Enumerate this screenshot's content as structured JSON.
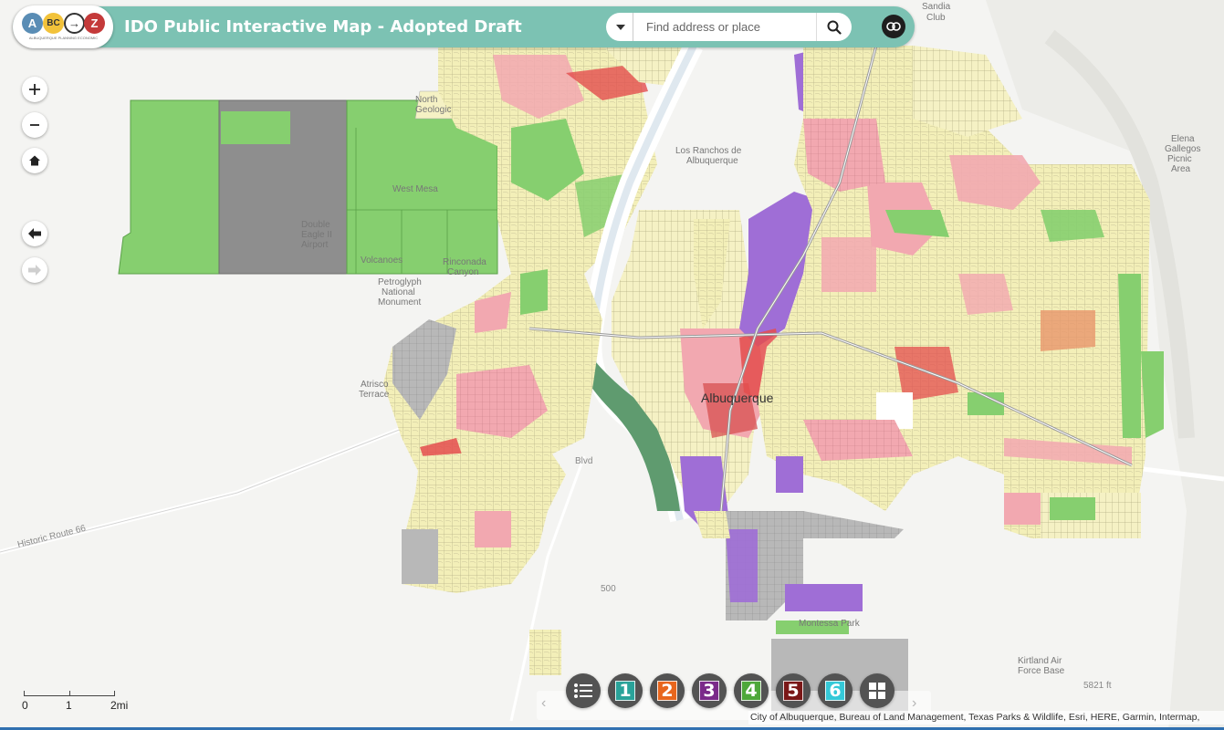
{
  "header": {
    "title": "IDO Public Interactive Map - Adopted Draft",
    "logo_letters": [
      "A",
      "BC",
      "→",
      "Z"
    ],
    "logo_tagline": "ALBUQUERQUE PLANNING ECONOMIC"
  },
  "search": {
    "placeholder": "Find address or place"
  },
  "map_labels": {
    "city": "Albuquerque",
    "los_ranchos": "Los Ranchos de",
    "los_ranchos_2": "Albuquerque",
    "west_mesa": "West Mesa",
    "double_eagle": "Double",
    "double_eagle_2": "Eagle II",
    "double_eagle_3": "Airport",
    "volcanoes": "Volcanoes",
    "rinconada": "Rinconada",
    "rinconada_2": "Canyon",
    "petroglyph": "Petroglyph",
    "petroglyph_2": "National",
    "petroglyph_3": "Monument",
    "atrisco": "Atrisco",
    "atrisco_2": "Terrace",
    "elena": "Elena",
    "elena_2": "Gallegos",
    "elena_3": "Picnic",
    "elena_4": "Area",
    "kirtland": "Kirtland Air",
    "kirtland_2": "Force Base",
    "sandia_club": "Club",
    "sandia": "Sandia",
    "historic_route": "Historic Route 66",
    "route_500": "500",
    "blvd": "Blvd",
    "elevation": "5821 ft",
    "montessa": "Montessa Park",
    "north_geologic": "North",
    "north_geologic_2": "Geologic"
  },
  "scale": {
    "labels": [
      "0",
      "1",
      "2mi"
    ]
  },
  "toolbar": {
    "buttons": [
      {
        "label": "1",
        "color": "#2aa39a"
      },
      {
        "label": "2",
        "color": "#e8661d"
      },
      {
        "label": "3",
        "color": "#7b2a8a"
      },
      {
        "label": "4",
        "color": "#4ea83a"
      },
      {
        "label": "5",
        "color": "#7a1717"
      },
      {
        "label": "6",
        "color": "#35c9d8"
      }
    ]
  },
  "attribution": "City of Albuquerque, Bureau of Land Management, Texas Parks & Wildlife, Esri, HERE, Garmin, Intermap,",
  "colors": {
    "header": "#7cc2b3",
    "open_space": "#86cf6f",
    "airport": "#8a8a8a",
    "residential": "#f3efb8",
    "commercial": "#f2a3ac",
    "industrial": "#9f6ed6",
    "mixed_use": "#e44e4e",
    "river": "#5f9b6f"
  }
}
